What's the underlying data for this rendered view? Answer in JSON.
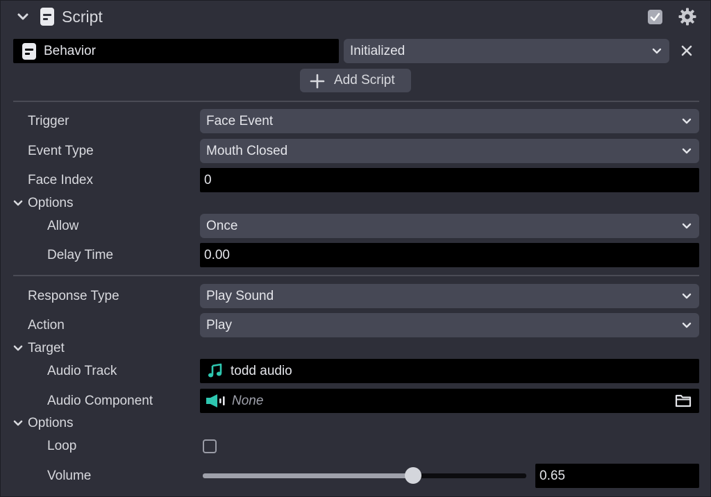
{
  "header": {
    "title": "Script",
    "enabled": true,
    "icons": {
      "collapse": "chevron-down-icon",
      "script": "script-file-icon",
      "settings": "gear-icon"
    }
  },
  "behavior": {
    "name": "Behavior",
    "state": "Initialized",
    "add_script_label": "Add Script"
  },
  "trigger_section": {
    "trigger": {
      "label": "Trigger",
      "value": "Face Event"
    },
    "event_type": {
      "label": "Event Type",
      "value": "Mouth Closed"
    },
    "face_index": {
      "label": "Face Index",
      "value": "0"
    },
    "options": {
      "label": "Options",
      "allow": {
        "label": "Allow",
        "value": "Once"
      },
      "delay_time": {
        "label": "Delay Time",
        "value": "0.00"
      }
    }
  },
  "response_section": {
    "response_type": {
      "label": "Response Type",
      "value": "Play Sound"
    },
    "action": {
      "label": "Action",
      "value": "Play"
    },
    "target": {
      "label": "Target",
      "audio_track": {
        "label": "Audio Track",
        "value": "todd audio"
      },
      "audio_component": {
        "label": "Audio Component",
        "value": "None"
      }
    },
    "options": {
      "label": "Options",
      "loop": {
        "label": "Loop",
        "checked": false
      },
      "volume": {
        "label": "Volume",
        "value": "0.65",
        "level": 0.65
      }
    }
  },
  "colors": {
    "panel_bg": "#2e2f39",
    "dropdown_bg": "#464855",
    "field_bg": "#000000",
    "accent_teal": "#2ec7b0",
    "text": "#d8d9de"
  }
}
